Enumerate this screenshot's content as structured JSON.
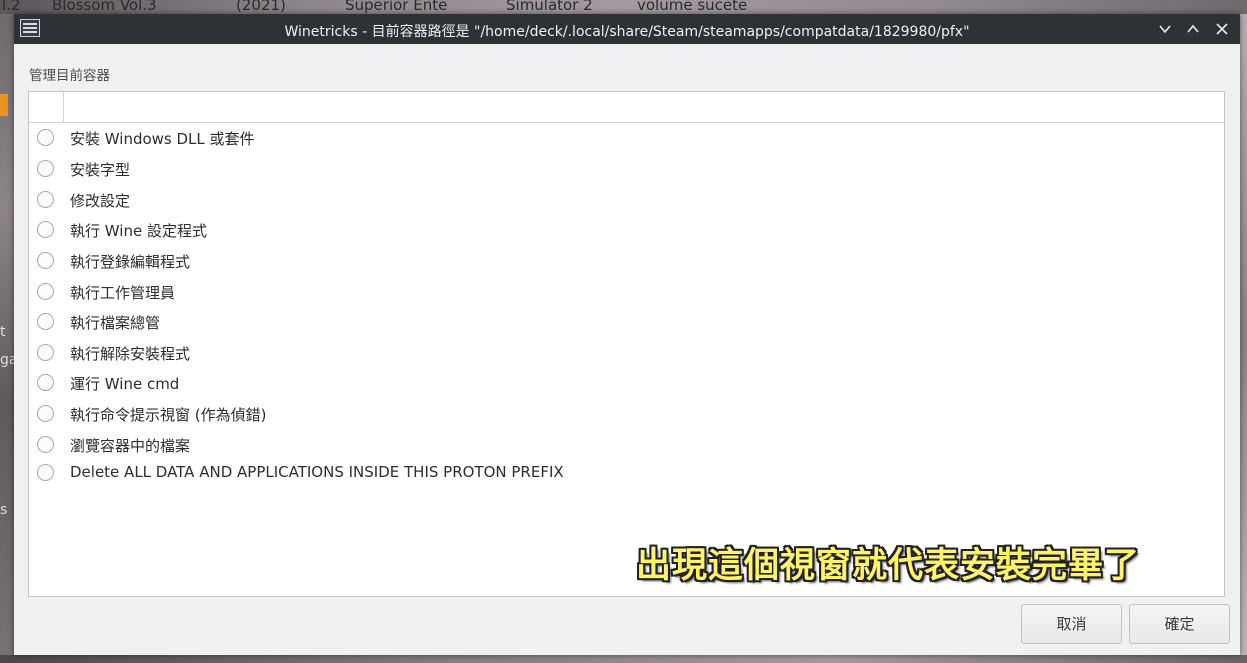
{
  "desktop": {
    "top_fragments": [
      "l.2",
      "Blossom Vol.3",
      "(2021)",
      "Superior Ente",
      "Simulator 2",
      "volume sucete"
    ],
    "left_fragments": [
      "t",
      "ga",
      "s"
    ]
  },
  "window": {
    "title": "Winetricks - 目前容器路徑是 \"/home/deck/.local/share/Steam/steamapps/compatdata/1829980/pfx\"",
    "icon": "app-menu-icon",
    "controls": {
      "minimize_icon": "chevron-down-icon",
      "maximize_icon": "chevron-up-icon",
      "close_icon": "close-icon",
      "minimize": "⌄",
      "maximize": "⌃",
      "close": "✕"
    }
  },
  "main": {
    "section_label": "管理目前容器",
    "options": [
      {
        "label": "安裝 Windows DLL 或套件",
        "selected": false
      },
      {
        "label": "安裝字型",
        "selected": false
      },
      {
        "label": "修改設定",
        "selected": false
      },
      {
        "label": "執行 Wine 設定程式",
        "selected": false
      },
      {
        "label": "執行登錄編輯程式",
        "selected": false
      },
      {
        "label": "執行工作管理員",
        "selected": false
      },
      {
        "label": "執行檔案總管",
        "selected": false
      },
      {
        "label": "執行解除安裝程式",
        "selected": false
      },
      {
        "label": "運行 Wine cmd",
        "selected": false
      },
      {
        "label": "執行命令提示視窗 (作為偵錯)",
        "selected": false
      },
      {
        "label": "瀏覽容器中的檔案",
        "selected": false
      },
      {
        "label": "Delete ALL DATA AND APPLICATIONS INSIDE THIS PROTON PREFIX",
        "selected": false
      }
    ]
  },
  "overlay_caption": "出現這個視窗就代表安裝完畢了",
  "buttons": {
    "cancel": "取消",
    "ok": "確定"
  }
}
